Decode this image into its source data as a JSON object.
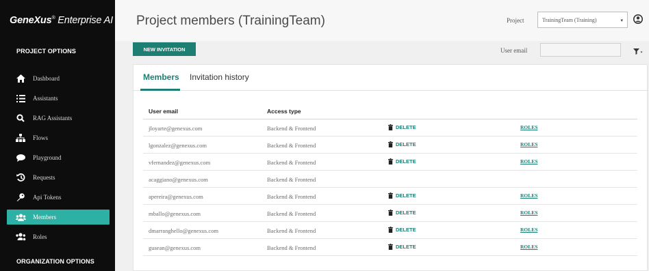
{
  "brand": {
    "name_bold": "GeneXus",
    "registered": "®",
    "name_rest": " Enterprise AI"
  },
  "sidebar": {
    "project_options_title": "PROJECT OPTIONS",
    "items": [
      {
        "label": "Dashboard",
        "icon": "home-icon"
      },
      {
        "label": "Assistants",
        "icon": "list-icon"
      },
      {
        "label": "RAG Assistants",
        "icon": "search-icon"
      },
      {
        "label": "Flows",
        "icon": "sitemap-icon"
      },
      {
        "label": "Playground",
        "icon": "chat-icon"
      },
      {
        "label": "Requests",
        "icon": "history-icon"
      },
      {
        "label": "Api Tokens",
        "icon": "key-icon"
      },
      {
        "label": "Members",
        "icon": "users-icon",
        "active": true
      },
      {
        "label": "Roles",
        "icon": "users-cog-icon"
      }
    ],
    "organization_options_title": "ORGANIZATION OPTIONS"
  },
  "header": {
    "title": "Project members (TrainingTeam)",
    "project_label": "Project",
    "project_selected": "TrainingTeam (Training)"
  },
  "toolbar": {
    "new_invitation_label": "NEW INVITATION",
    "user_email_label": "User email",
    "user_email_value": ""
  },
  "tabs": [
    {
      "label": "Members",
      "active": true
    },
    {
      "label": "Invitation history",
      "active": false
    }
  ],
  "table": {
    "columns": [
      "User email",
      "Access type"
    ],
    "delete_label": "DELETE",
    "roles_label": "ROLES",
    "rows": [
      {
        "email": "jloyarte@genexus.com",
        "access": "Backend & Frontend",
        "actions": true
      },
      {
        "email": "lgonzalez@genexus.com",
        "access": "Backend & Frontend",
        "actions": true
      },
      {
        "email": "vfernandez@genexus.com",
        "access": "Backend & Frontend",
        "actions": true
      },
      {
        "email": "acaggiano@genexus.com",
        "access": "Backend & Frontend",
        "actions": false
      },
      {
        "email": "apereira@genexus.com",
        "access": "Backend & Frontend",
        "actions": true
      },
      {
        "email": "mballo@genexus.com",
        "access": "Backend & Frontend",
        "actions": true
      },
      {
        "email": "dmarranghello@genexus.com",
        "access": "Backend & Frontend",
        "actions": true
      },
      {
        "email": "gusean@genexus.com",
        "access": "Backend & Frontend",
        "actions": true
      }
    ]
  },
  "colors": {
    "sidebar_bg": "#0d0d0d",
    "accent": "#1d7f73",
    "active_item": "#2db1a4"
  }
}
